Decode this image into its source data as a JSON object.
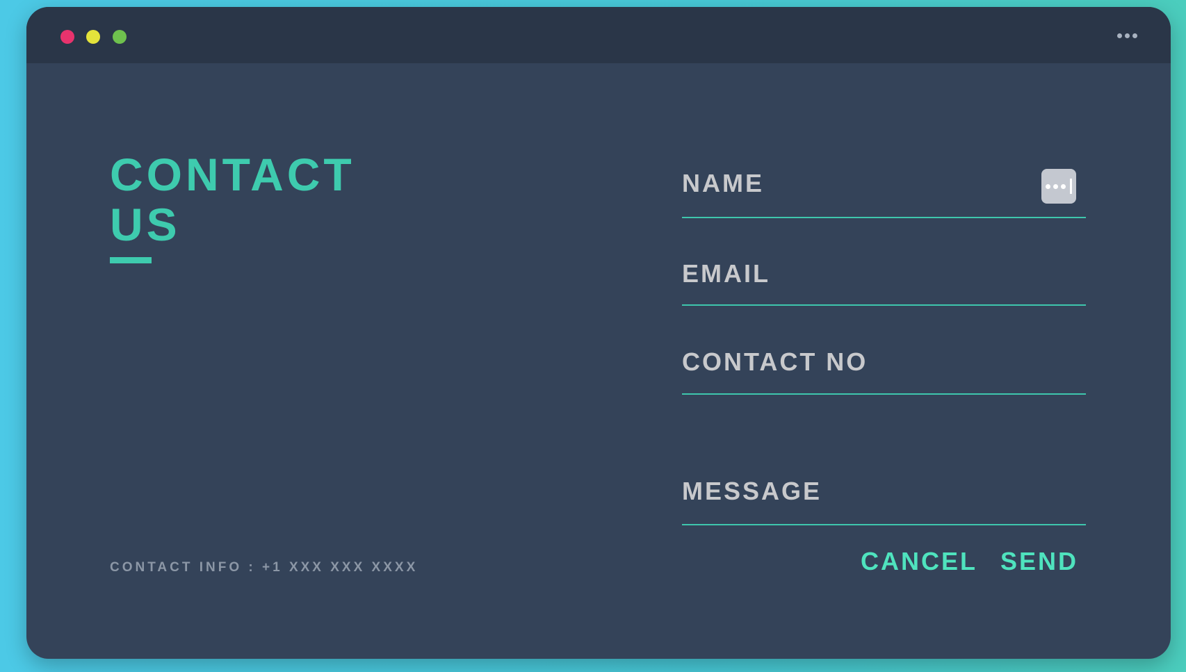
{
  "window": {
    "controls": [
      "close",
      "minimize",
      "maximize"
    ],
    "menu_icon": "more-horizontal-icon"
  },
  "heading": {
    "line1": "CONTACT",
    "line2": "US"
  },
  "form": {
    "name_label": "NAME",
    "email_label": "EMAIL",
    "phone_label": "CONTACT NO",
    "message_label": "MESSAGE",
    "autofill_icon": "password-autofill-icon"
  },
  "actions": {
    "cancel_label": "CANCEL",
    "send_label": "SEND"
  },
  "footer": {
    "contact_info": "CONTACT INFO : +1 XXX XXX XXXX"
  },
  "colors": {
    "accent": "#3ecbae",
    "button": "#4fe3be",
    "panel": "#344359",
    "titlebar": "#2a3648",
    "close": "#e8336d",
    "minimize": "#e4e33b",
    "maximize": "#6fc14e"
  }
}
